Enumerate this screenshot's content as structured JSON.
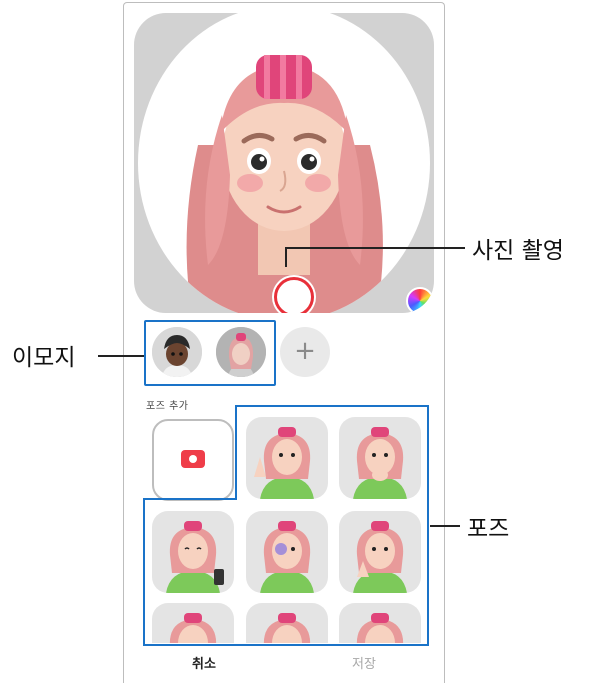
{
  "camera": {
    "shutter_label": "",
    "colors": {
      "shutter_ring": "#e8303a",
      "background": "#d2d2d2"
    }
  },
  "emoji_selector": {
    "add_symbol": "+"
  },
  "poses": {
    "section_title": "포즈 추가",
    "tile_count": 9
  },
  "bottom_bar": {
    "cancel_label": "취소",
    "save_label": "저장"
  },
  "callouts": {
    "shutter": "사진 촬영",
    "emoji": "이모지",
    "poses": "포즈"
  },
  "colors": {
    "bracket": "#1a73c8",
    "hair": "#e89a9a",
    "hair_roller": "#e0457a",
    "shirt": "#7dc95a"
  }
}
